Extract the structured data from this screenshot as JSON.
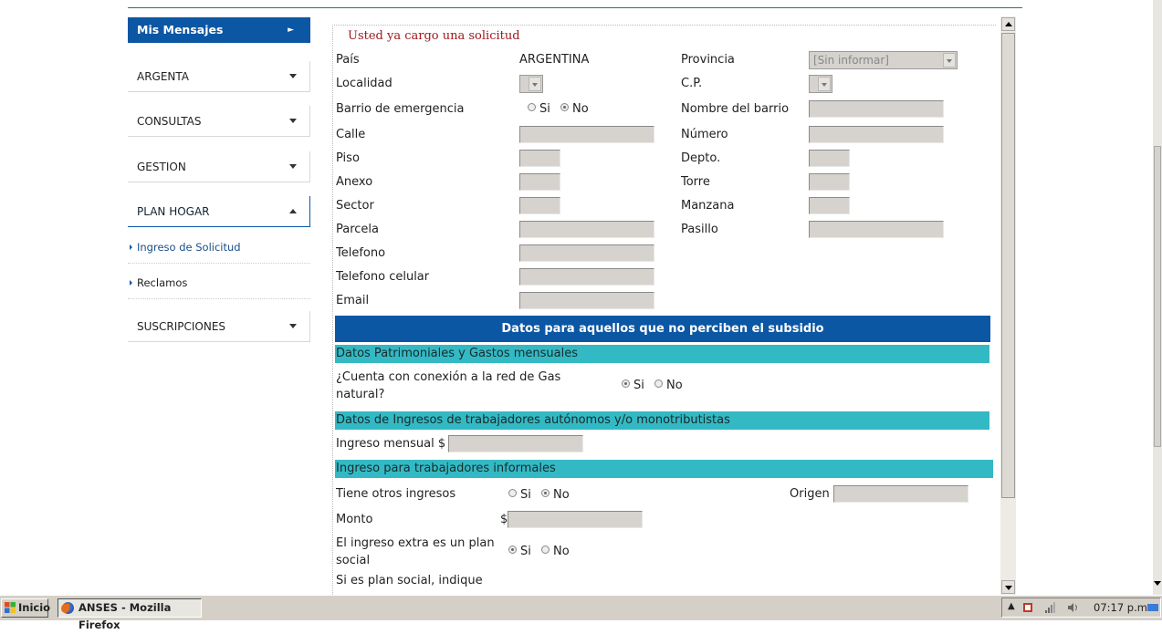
{
  "sidebar": {
    "header": "Mis Mensajes",
    "menus": [
      "ARGENTA",
      "CONSULTAS",
      "GESTION",
      "PLAN HOGAR"
    ],
    "plan_hogar_items": [
      "Ingreso de Solicitud",
      "Reclamos"
    ],
    "last_menu": "SUSCRIPCIONES"
  },
  "form": {
    "notice": "Usted ya cargo una solicitud",
    "pais_label": "País",
    "pais_value": "ARGENTINA",
    "provincia_label": "Provincia",
    "provincia_value": "[Sin informar]",
    "localidad_label": "Localidad",
    "cp_label": "C.P.",
    "barrio_emergencia_label": "Barrio de emergencia",
    "si": "Si",
    "no": "No",
    "nombre_barrio_label": "Nombre del barrio",
    "calle_label": "Calle",
    "numero_label": "Número",
    "piso_label": "Piso",
    "depto_label": "Depto.",
    "anexo_label": "Anexo",
    "torre_label": "Torre",
    "sector_label": "Sector",
    "manzana_label": "Manzana",
    "parcela_label": "Parcela",
    "pasillo_label": "Pasillo",
    "telefono_label": "Telefono",
    "celular_label": "Telefono celular",
    "email_label": "Email",
    "section_title": "Datos para aquellos que no perciben el subsidio",
    "patrimoniales_title": "Datos Patrimoniales y Gastos mensuales",
    "gas_label": "¿Cuenta con conexión a la red de Gas natural?",
    "autonomos_title": "Datos de Ingresos de trabajadores autónomos y/o monotributistas",
    "ingreso_mensual_label": "Ingreso mensual $",
    "informales_title": "Ingreso para trabajadores informales",
    "otros_ingresos_label": "Tiene otros ingresos",
    "origen_label": "Origen",
    "monto_label": "Monto",
    "dollar": "$",
    "plan_social_label": "El ingreso extra es un plan social",
    "si_plan_label": "Si es plan social, indique"
  },
  "taskbar": {
    "start": "Inicio",
    "window": "ANSES - Mozilla Firefox",
    "clock": "07:17 p.m."
  }
}
